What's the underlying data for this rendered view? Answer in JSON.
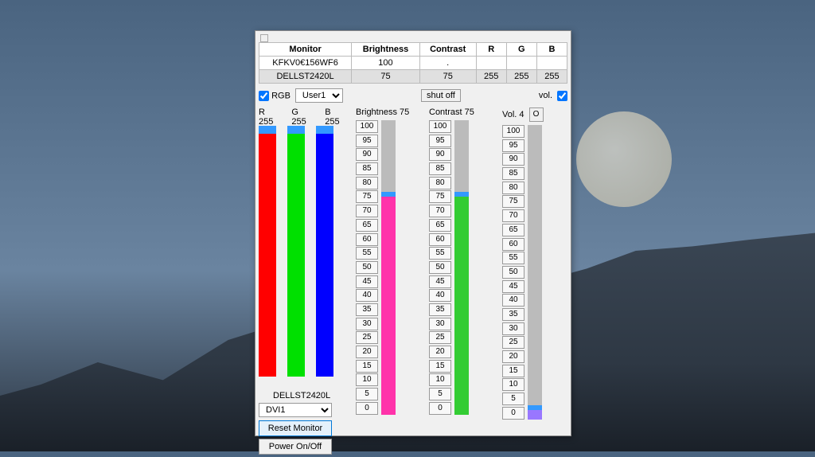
{
  "table": {
    "headers": [
      "Monitor",
      "Brightness",
      "Contrast",
      "R",
      "G",
      "B"
    ],
    "rows": [
      [
        "KFKV0€156WF6",
        "100",
        ".",
        "",
        "",
        ""
      ],
      [
        "DELLST2420L",
        "75",
        "75",
        "255",
        "255",
        "255"
      ]
    ],
    "selectedRow": 1
  },
  "rgb": {
    "checkbox_label": "RGB",
    "preset": "User1",
    "r_label": "R 255",
    "g_label": "G 255",
    "b_label": "B 255",
    "r": 255,
    "g": 255,
    "b": 255,
    "colors": {
      "r": "#ff0000",
      "g": "#00e000",
      "b": "#0000ff"
    }
  },
  "monitor_panel": {
    "name": "DELLST2420L",
    "input": "DVI1",
    "reset_label": "Reset Monitor",
    "power_label": "Power On/Off"
  },
  "brightness": {
    "label": "Brightness 75",
    "value": 75,
    "fill_color": "#ff33aa"
  },
  "contrast": {
    "label": "Contrast 75",
    "value": 75,
    "fill_color": "#33cc33"
  },
  "volume": {
    "label": "Vol. 4",
    "value": 4,
    "fill_color": "#9977ff",
    "button_label": "O",
    "checkbox_label": "vol."
  },
  "shutoff_label": "shut off",
  "ticks": [
    100,
    95,
    90,
    85,
    80,
    75,
    70,
    65,
    60,
    55,
    50,
    45,
    40,
    35,
    30,
    25,
    20,
    15,
    10,
    5,
    0
  ]
}
